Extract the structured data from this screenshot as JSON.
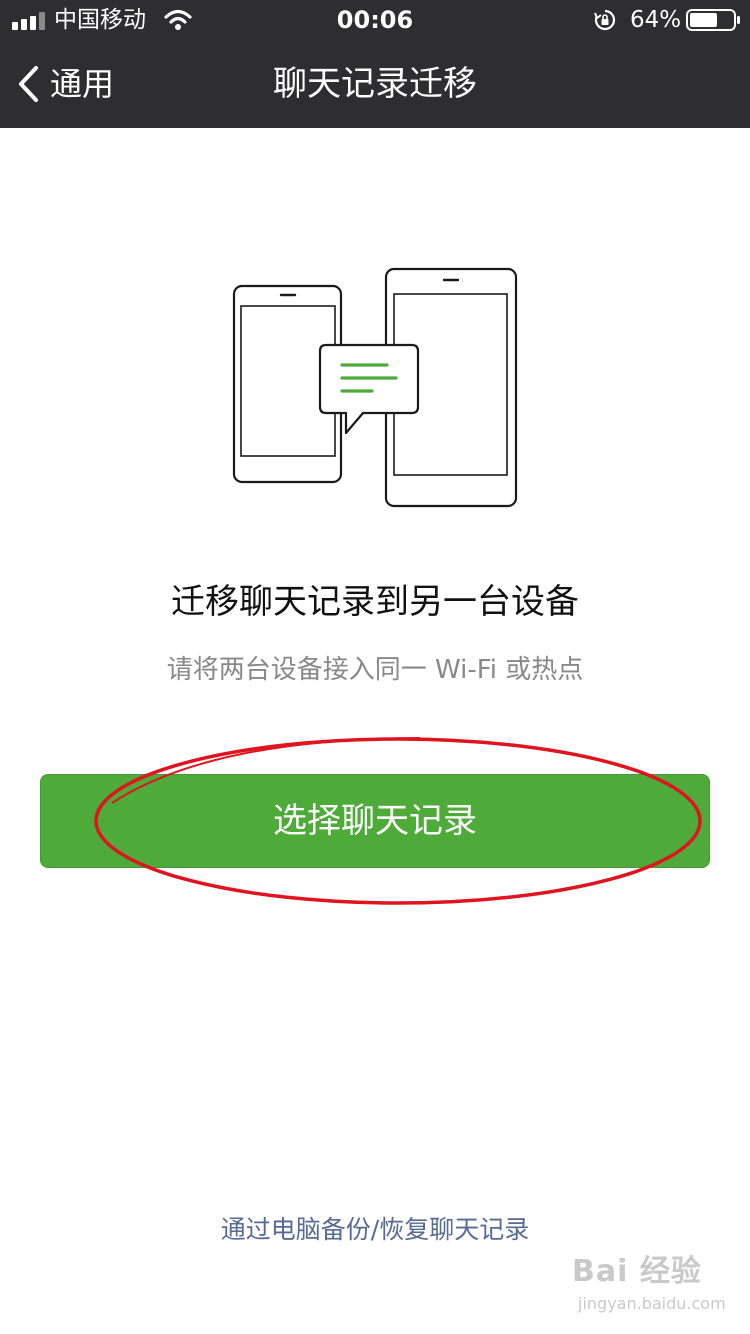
{
  "status_bar": {
    "carrier": "中国移动",
    "time": "00:06",
    "battery_percent": "64%",
    "battery_level": 0.64,
    "icons": [
      "signal-icon",
      "wifi-icon",
      "orientation-lock-icon",
      "battery-icon"
    ]
  },
  "nav": {
    "back_label": "通用",
    "title": "聊天记录迁移"
  },
  "main": {
    "illustration": "two-phones-chat-transfer",
    "heading": "迁移聊天记录到另一台设备",
    "subtitle": "请将两台设备接入同一 Wi-Fi 或热点",
    "primary_button": "选择聊天记录"
  },
  "footer": {
    "pc_link": "通过电脑备份/恢复聊天记录"
  },
  "watermark": {
    "main": "Bai 经验",
    "sub": "jingyan.baidu.com"
  },
  "colors": {
    "header_bg": "#2e2e30",
    "primary_green": "#4eab3a",
    "link_blue": "#576b95",
    "annotation_red": "#e0141e"
  }
}
